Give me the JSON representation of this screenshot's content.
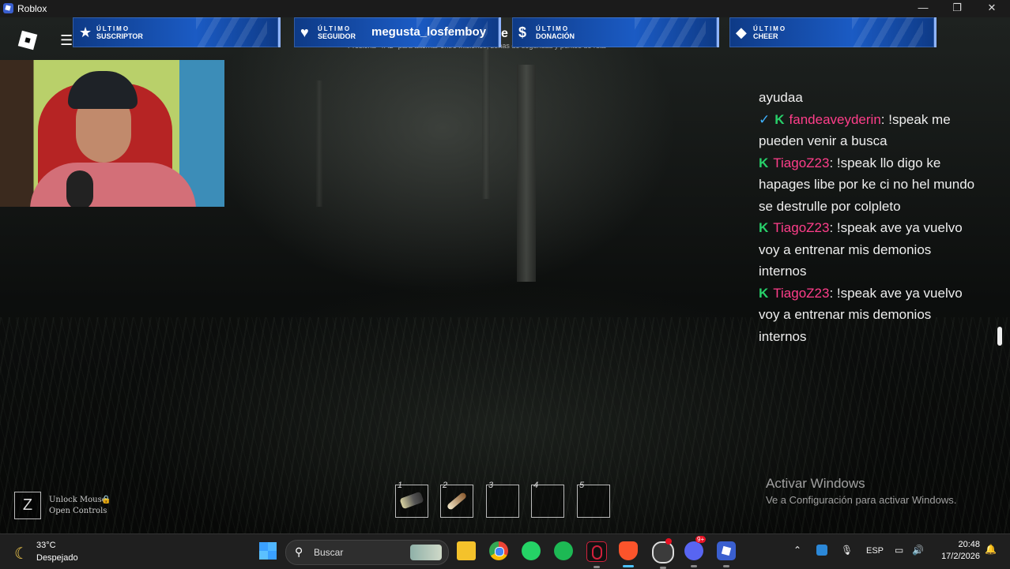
{
  "window": {
    "title": "Roblox",
    "controls": {
      "minimize": "—",
      "maximize": "❐",
      "close": "✕"
    }
  },
  "game": {
    "menu_icon": "hamburger-menu-icon",
    "mission_hint": "Presiona \"TAB\" para alternar entre misiones, zonas de seguridad y puntos de ruta",
    "behind_alert_letter": "e"
  },
  "stream_alerts": [
    {
      "icon": "star-icon",
      "glyph": "★",
      "top": "ÚLTIMO",
      "bottom": "SUSCRIPTOR",
      "value": ""
    },
    {
      "icon": "heart-icon",
      "glyph": "♥",
      "top": "ÚLTIMO",
      "bottom": "SEGUIDOR",
      "value": "megusta_losfemboy"
    },
    {
      "icon": "dollar-icon",
      "glyph": "$",
      "top": "ÚLTIMO",
      "bottom": "DONACIÓN",
      "value": ""
    },
    {
      "icon": "diamond-icon",
      "glyph": "◆",
      "top": "ÚLTIMO",
      "bottom": "CHEER",
      "value": ""
    }
  ],
  "chat": {
    "lines": [
      {
        "text": "ayudaa"
      },
      {
        "badges": [
          "✓",
          "K"
        ],
        "user": "fandeaveyderin",
        "text": ": !speak me pueden venir a busca"
      },
      {
        "badges": [
          "K"
        ],
        "user": "TiagoZ23",
        "text": ": !speak llo digo ke hapages libe por ke ci no hel mundo se destrulle por colpleto"
      },
      {
        "badges": [
          "K"
        ],
        "user": "TiagoZ23",
        "text": ": !speak ave ya vuelvo voy a entrenar mis demonios internos"
      },
      {
        "badges": [
          "K"
        ],
        "user": "TiagoZ23",
        "text": ": !speak ave ya vuelvo voy a entrenar mis demonios internos"
      }
    ],
    "colors": {
      "username": "#ff3e8a",
      "badge_green": "#28d06a",
      "badge_blue": "#3fb1ff"
    }
  },
  "activation_watermark": {
    "title": "Activar Windows",
    "subtitle": "Ve a Configuración para activar Windows."
  },
  "controls_hint": {
    "key": "Z",
    "line1": "Unlock Mouse",
    "line2": "Open Controls",
    "lock_icon": "lock-icon"
  },
  "hotbar": {
    "slots": [
      {
        "number": "1",
        "item": "flashlight"
      },
      {
        "number": "2",
        "item": "torch"
      },
      {
        "number": "3",
        "item": ""
      },
      {
        "number": "4",
        "item": ""
      },
      {
        "number": "5",
        "item": ""
      }
    ]
  },
  "taskbar": {
    "weather": {
      "temp": "33°C",
      "condition": "Despejado",
      "icon": "moon-icon"
    },
    "search_placeholder": "Buscar",
    "apps": [
      {
        "name": "file-explorer",
        "color": "#f4c22b"
      },
      {
        "name": "chrome",
        "color": "#e94335"
      },
      {
        "name": "whatsapp",
        "color": "#25d366"
      },
      {
        "name": "spotify",
        "color": "#1db954"
      },
      {
        "name": "opera-gx",
        "color": "#d1213c"
      },
      {
        "name": "brave",
        "color": "#fb542b"
      },
      {
        "name": "obs",
        "color": "#3b3b3b"
      },
      {
        "name": "discord",
        "color": "#5865f2",
        "badge": "9+"
      },
      {
        "name": "roblox",
        "color": "#3a5fcf"
      }
    ],
    "tray": {
      "language": "ESP"
    },
    "clock": {
      "time": "20:48",
      "date": "17/2/2026"
    }
  }
}
